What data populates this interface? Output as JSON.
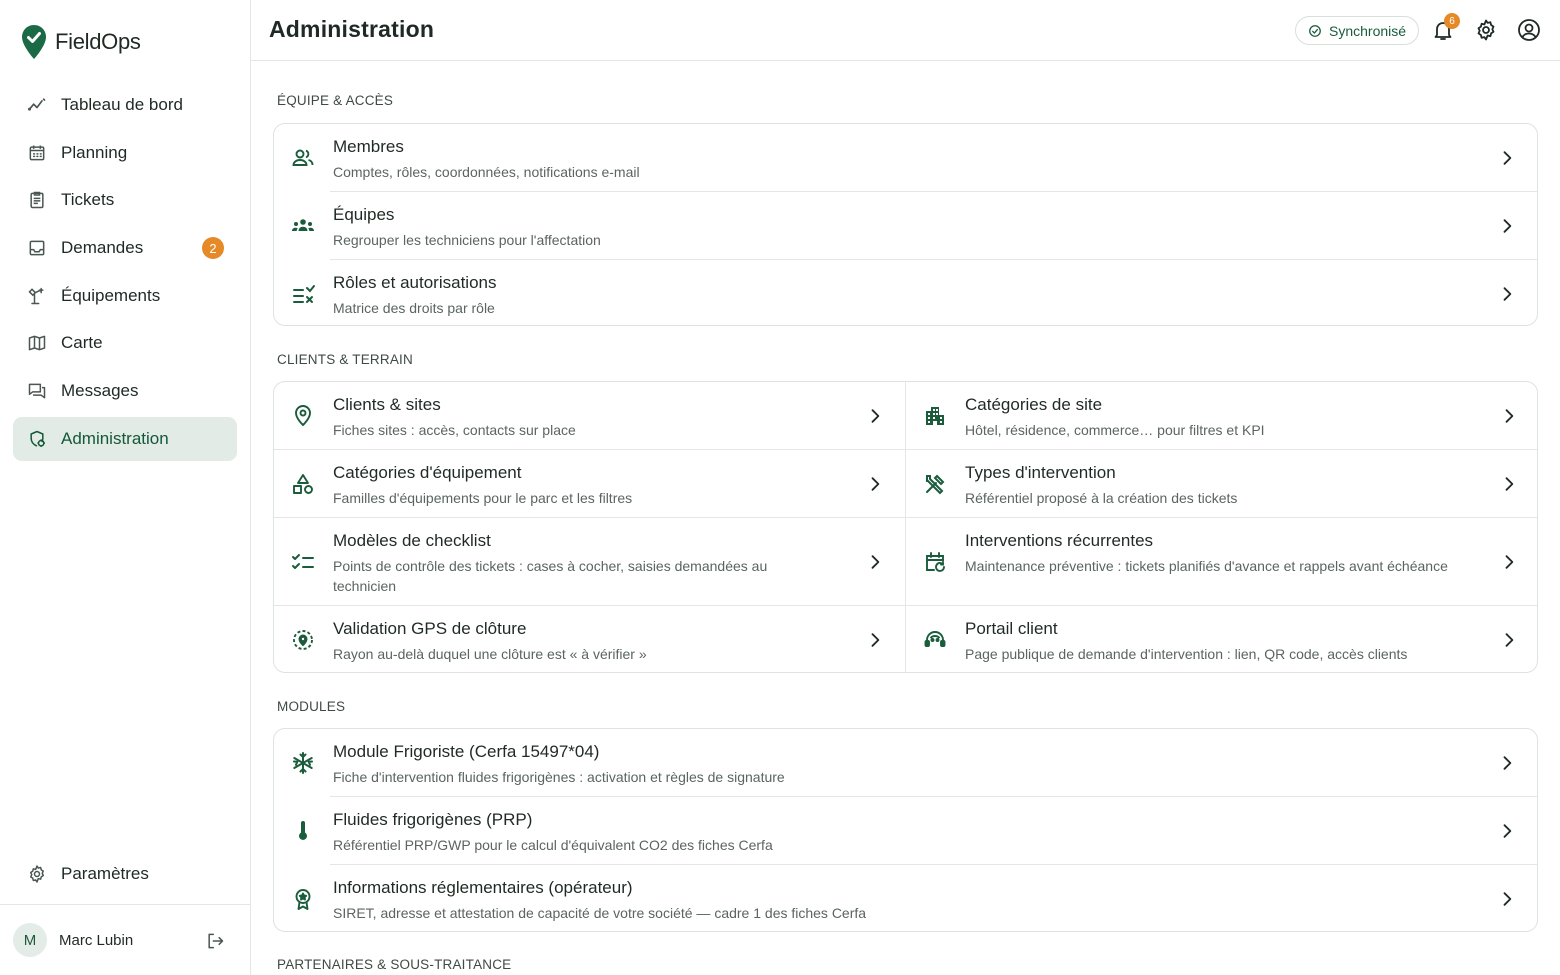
{
  "app": {
    "name": "FieldOps"
  },
  "sidebar": {
    "items": [
      {
        "label": "Tableau de bord",
        "icon": "chart-line-icon"
      },
      {
        "label": "Planning",
        "icon": "calendar-icon"
      },
      {
        "label": "Tickets",
        "icon": "clipboard-icon"
      },
      {
        "label": "Demandes",
        "icon": "inbox-icon",
        "badge": "2"
      },
      {
        "label": "Équipements",
        "icon": "equipment-icon"
      },
      {
        "label": "Carte",
        "icon": "map-icon"
      },
      {
        "label": "Messages",
        "icon": "messages-icon"
      },
      {
        "label": "Administration",
        "icon": "admin-icon",
        "active": true
      }
    ],
    "settings_label": "Paramètres",
    "user": {
      "initial": "M",
      "name": "Marc Lubin"
    }
  },
  "header": {
    "title": "Administration",
    "sync_label": "Synchronisé",
    "notifications_count": "6"
  },
  "sections": {
    "team": {
      "title": "ÉQUIPE & ACCÈS",
      "items": [
        {
          "title": "Membres",
          "desc": "Comptes, rôles, coordonnées, notifications e-mail"
        },
        {
          "title": "Équipes",
          "desc": "Regrouper les techniciens pour l'affectation"
        },
        {
          "title": "Rôles et autorisations",
          "desc": "Matrice des droits par rôle"
        }
      ]
    },
    "clients": {
      "title": "CLIENTS & TERRAIN",
      "items": [
        {
          "title": "Clients & sites",
          "desc": "Fiches sites : accès, contacts sur place"
        },
        {
          "title": "Catégories de site",
          "desc": "Hôtel, résidence, commerce… pour filtres et KPI"
        },
        {
          "title": "Catégories d'équipement",
          "desc": "Familles d'équipements pour le parc et les filtres"
        },
        {
          "title": "Types d'intervention",
          "desc": "Référentiel proposé à la création des tickets"
        },
        {
          "title": "Modèles de checklist",
          "desc": "Points de contrôle des tickets : cases à cocher, saisies demandées au technicien"
        },
        {
          "title": "Interventions récurrentes",
          "desc": "Maintenance préventive : tickets planifiés d'avance et rappels avant échéance"
        },
        {
          "title": "Validation GPS de clôture",
          "desc": "Rayon au-delà duquel une clôture est « à vérifier »"
        },
        {
          "title": "Portail client",
          "desc": "Page publique de demande d'intervention : lien, QR code, accès clients"
        }
      ]
    },
    "modules": {
      "title": "MODULES",
      "items": [
        {
          "title": "Module Frigoriste (Cerfa 15497*04)",
          "desc": "Fiche d'intervention fluides frigorigènes : activation et règles de signature"
        },
        {
          "title": "Fluides frigorigènes (PRP)",
          "desc": "Référentiel PRP/GWP pour le calcul d'équivalent CO2 des fiches Cerfa"
        },
        {
          "title": "Informations réglementaires (opérateur)",
          "desc": "SIRET, adresse et attestation de capacité de votre société — cadre 1 des fiches Cerfa"
        }
      ]
    },
    "partners": {
      "title": "PARTENAIRES & SOUS-TRAITANCE"
    }
  },
  "colors": {
    "brand": "#1a5c3c",
    "accent_badge": "#e58a27",
    "active_bg": "#e2ebe6"
  }
}
